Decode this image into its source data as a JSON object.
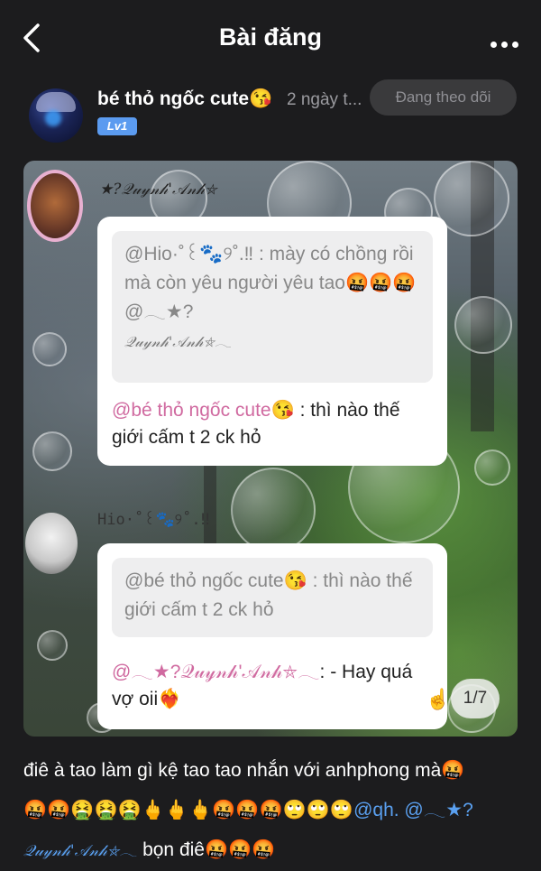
{
  "header": {
    "title": "Bài đăng",
    "back_icon": "chevron-left-icon",
    "more_icon": "more-horizontal-icon"
  },
  "author": {
    "name": "bé thỏ ngốc cute😘",
    "time": "2 ngày t...",
    "level": "Lv1",
    "follow_label": "Đang theo dõi"
  },
  "image": {
    "counter": "1/7",
    "comment1_name": "★?𝒬𝓊𝓎𝓃𝒽'𝒜𝓃𝒽⛤",
    "quote1_text": "@Hio·˚꒰🐾୨˚.‼ : mày có chồng rồi mà còn yêu người yêu tao🤬🤬🤬@𓂃★?",
    "quote1_sig": "𝒬𝓊𝓎𝓃𝒽'𝒜𝓃𝒽⛤𓂃",
    "reply1_mention": "@bé thỏ ngốc cute😘",
    "reply1_text": " : thì nào thế giới cấm t 2 ck hỏ",
    "comment2_name": "Hio·˚꒰🐾୨˚.‼",
    "quote2_text": "@bé thỏ ngốc cute😘 : thì nào thế giới cấm t 2 ck hỏ",
    "reply2_mention": "@𓂃★?𝒬𝓊𝓎𝓃𝒽'𝒜𝓃𝒽⛤𓂃",
    "reply2_text": ": - Hay quá vợ oii❤️‍🔥"
  },
  "caption": {
    "line1": "điê à tao làm gì kệ tao tao nhắn với anhphong mà🤬",
    "line2_emojis": "🤬🤬🤮🤮🤮🖕🖕🖕🤬🤬🤬🙄🙄🙄",
    "mention_qh": "@qh.",
    "mention_anh": " @𓂃★?",
    "sig": "𝒬𝓊𝓎𝓃𝒽'𝒜𝓃𝒽⛤𓂃",
    "tail": " bọn điê🤬🤬🤬"
  }
}
